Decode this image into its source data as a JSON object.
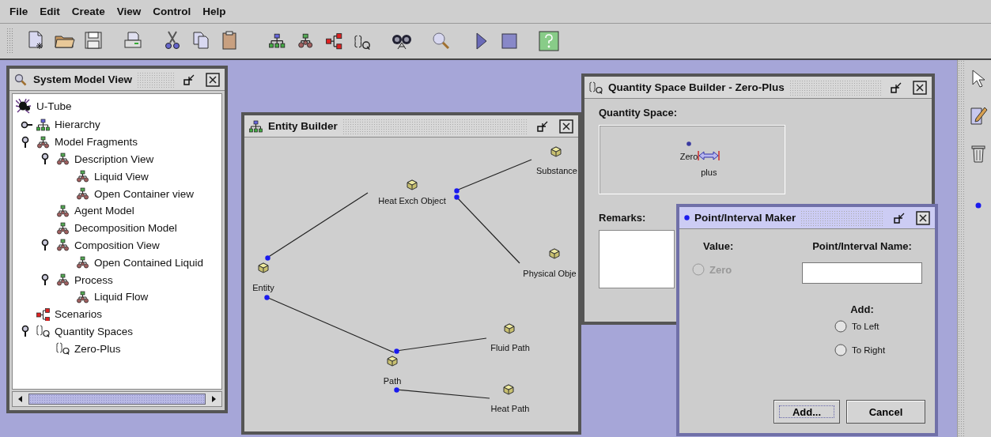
{
  "menu": [
    {
      "label": "File"
    },
    {
      "label": "Edit"
    },
    {
      "label": "Create"
    },
    {
      "label": "View"
    },
    {
      "label": "Control"
    },
    {
      "label": "Help"
    }
  ],
  "system_model_view": {
    "title": "System Model View",
    "tree": [
      {
        "label": "U-Tube",
        "kind": "root",
        "children": [
          {
            "label": "Hierarchy",
            "kind": "hierarchy",
            "expanded": false
          },
          {
            "label": "Model Fragments",
            "kind": "fragment",
            "expanded": true,
            "children": [
              {
                "label": "Description View",
                "kind": "fragment",
                "expanded": true,
                "children": [
                  {
                    "label": "Liquid View",
                    "kind": "fragment"
                  },
                  {
                    "label": "Open Container view",
                    "kind": "fragment"
                  }
                ]
              },
              {
                "label": "Agent Model",
                "kind": "fragment"
              },
              {
                "label": "Decomposition Model",
                "kind": "fragment"
              },
              {
                "label": "Composition View",
                "kind": "fragment",
                "expanded": true,
                "children": [
                  {
                    "label": "Open Contained Liquid",
                    "kind": "fragment"
                  }
                ]
              },
              {
                "label": "Process",
                "kind": "fragment",
                "expanded": true,
                "children": [
                  {
                    "label": "Liquid Flow",
                    "kind": "fragment"
                  }
                ]
              }
            ]
          },
          {
            "label": "Scenarios",
            "kind": "scenario"
          },
          {
            "label": "Quantity Spaces",
            "kind": "quantity",
            "expanded": true,
            "children": [
              {
                "label": "Zero-Plus",
                "kind": "quantity"
              }
            ]
          }
        ]
      }
    ]
  },
  "entity_builder": {
    "title": "Entity Builder",
    "nodes": [
      {
        "label": "Entity",
        "children": [
          {
            "label": "Heat Exch Object",
            "children": [
              {
                "label": "Substance"
              },
              {
                "label": "Physical Obje"
              }
            ]
          },
          {
            "label": "Path",
            "children": [
              {
                "label": "Fluid Path"
              },
              {
                "label": "Heat Path"
              }
            ]
          }
        ]
      }
    ]
  },
  "quantity_space_builder": {
    "title": "Quantity Space Builder - Zero-Plus",
    "quantity_space_label": "Quantity Space:",
    "values": [
      {
        "kind": "point",
        "label": "Zero"
      },
      {
        "kind": "interval",
        "label": "plus"
      }
    ],
    "remarks_label": "Remarks:"
  },
  "point_interval_maker": {
    "title": "Point/Interval Maker",
    "value_label": "Value:",
    "value_options": [
      {
        "label": "Zero",
        "selected": false,
        "disabled": true
      }
    ],
    "name_label": "Point/Interval Name:",
    "add_label": "Add:",
    "add_options": [
      {
        "label": "To Left",
        "selected": false,
        "disabled": false
      },
      {
        "label": "To Right",
        "selected": false,
        "disabled": false
      }
    ],
    "buttons": [
      {
        "label": "Add...",
        "focused": true
      },
      {
        "label": "Cancel",
        "focused": false
      }
    ]
  }
}
